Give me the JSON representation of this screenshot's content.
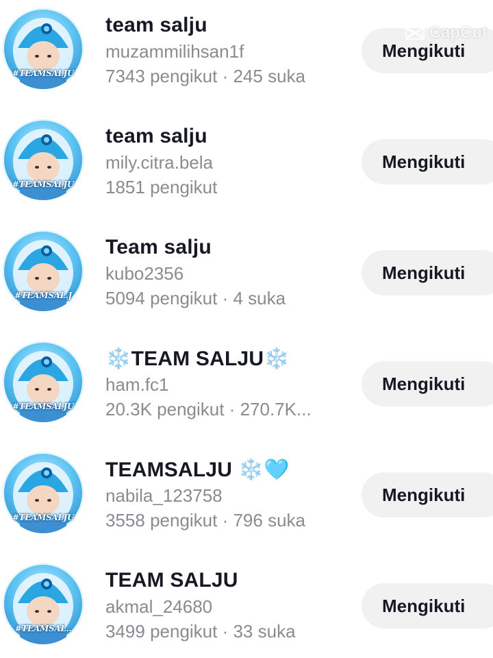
{
  "watermark": {
    "icon": "capcut-logo-icon",
    "text": "CapCut"
  },
  "avatar_tags": [
    "#TEAMSALJU",
    "#TEAMSALJU",
    "#TEAMSAL.J",
    "#TEAMSALJU",
    "#TEAMSALJU",
    "#TEAMSAL.."
  ],
  "accounts": [
    {
      "name": "team salju",
      "handle": "muzammilihsan1f",
      "stats": "7343 pengikut · 245 suka",
      "button": "Mengikuti"
    },
    {
      "name": "team salju",
      "handle": "mily.citra.bela",
      "stats": "1851 pengikut",
      "button": "Mengikuti"
    },
    {
      "name": "Team salju",
      "handle": "kubo2356",
      "stats": "5094 pengikut · 4 suka",
      "button": "Mengikuti"
    },
    {
      "name_prefix": "❄️",
      "name": "TEAM SALJU",
      "name_suffix": "❄️",
      "handle": "ham.fc1",
      "stats": "20.3K pengikut · 270.7K...",
      "button": "Mengikuti"
    },
    {
      "name": "TEAMSALJU",
      "name_suffix": "❄️",
      "name_heart": "🩵",
      "handle": "nabila_123758",
      "stats": "3558 pengikut · 796 suka",
      "button": "Mengikuti"
    },
    {
      "name": "TEAM SALJU",
      "handle": "akmal_24680",
      "stats": "3499 pengikut · 33 suka",
      "button": "Mengikuti"
    }
  ]
}
